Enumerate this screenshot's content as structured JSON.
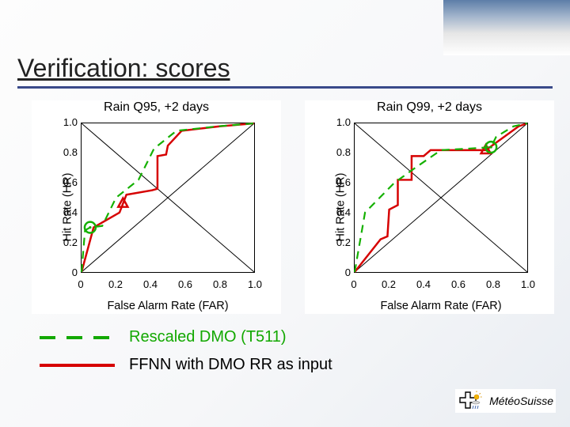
{
  "slide": {
    "title": "Verification: scores"
  },
  "legend": {
    "dashed_label": "Rescaled DMO (T511)",
    "solid_label": "FFNN with DMO RR as input"
  },
  "logo_text": "MétéoSuisse",
  "chart_data": [
    {
      "type": "line",
      "title": "Rain Q95, +2 days",
      "xlabel": "False Alarm Rate (FAR)",
      "ylabel": "Hit Rate (HR)",
      "xlim": [
        0,
        1.0
      ],
      "ylim": [
        0,
        1.0
      ],
      "xticks": [
        0,
        0.2,
        0.4,
        0.6,
        0.8,
        1.0
      ],
      "yticks": [
        0,
        0.2,
        0.4,
        0.6,
        0.8,
        1.0
      ],
      "series": [
        {
          "name": "FFNN",
          "style": "solid-red",
          "points": [
            [
              0.0,
              0.0
            ],
            [
              0.07,
              0.3
            ],
            [
              0.22,
              0.4
            ],
            [
              0.24,
              0.46
            ],
            [
              0.26,
              0.52
            ],
            [
              0.41,
              0.55
            ],
            [
              0.44,
              0.56
            ],
            [
              0.44,
              0.78
            ],
            [
              0.49,
              0.79
            ],
            [
              0.5,
              0.85
            ],
            [
              0.58,
              0.95
            ],
            [
              0.8,
              0.98
            ],
            [
              1.0,
              1.0
            ]
          ],
          "marker": {
            "shape": "triangle",
            "at": [
              0.24,
              0.46
            ]
          }
        },
        {
          "name": "Rescaled DMO",
          "style": "dashed-green",
          "points": [
            [
              0.0,
              0.0
            ],
            [
              0.02,
              0.28
            ],
            [
              0.05,
              0.3
            ],
            [
              0.12,
              0.31
            ],
            [
              0.2,
              0.5
            ],
            [
              0.33,
              0.62
            ],
            [
              0.42,
              0.83
            ],
            [
              0.55,
              0.95
            ],
            [
              0.79,
              0.98
            ],
            [
              1.0,
              1.0
            ]
          ],
          "marker": {
            "shape": "circle-dot",
            "at": [
              0.05,
              0.3
            ]
          }
        }
      ],
      "reference_diagonal": true
    },
    {
      "type": "line",
      "title": "Rain Q99, +2 days",
      "xlabel": "False Alarm Rate (FAR)",
      "ylabel": "Hit Rate (HR)",
      "xlim": [
        0,
        1.0
      ],
      "ylim": [
        0,
        1.0
      ],
      "xticks": [
        0,
        0.2,
        0.4,
        0.6,
        0.8,
        1.0
      ],
      "yticks": [
        0,
        0.2,
        0.4,
        0.6,
        0.8,
        1.0
      ],
      "series": [
        {
          "name": "FFNN",
          "style": "solid-red",
          "points": [
            [
              0.0,
              0.0
            ],
            [
              0.15,
              0.22
            ],
            [
              0.19,
              0.24
            ],
            [
              0.2,
              0.42
            ],
            [
              0.25,
              0.45
            ],
            [
              0.25,
              0.62
            ],
            [
              0.33,
              0.62
            ],
            [
              0.33,
              0.78
            ],
            [
              0.4,
              0.78
            ],
            [
              0.44,
              0.82
            ],
            [
              0.71,
              0.82
            ],
            [
              0.76,
              0.82
            ],
            [
              0.95,
              0.98
            ],
            [
              1.0,
              1.0
            ]
          ],
          "marker": {
            "shape": "triangle",
            "at": [
              0.76,
              0.82
            ]
          }
        },
        {
          "name": "Rescaled DMO",
          "style": "dashed-green",
          "points": [
            [
              0.0,
              0.0
            ],
            [
              0.06,
              0.4
            ],
            [
              0.23,
              0.6
            ],
            [
              0.35,
              0.7
            ],
            [
              0.5,
              0.82
            ],
            [
              0.66,
              0.83
            ],
            [
              0.79,
              0.84
            ],
            [
              0.82,
              0.91
            ],
            [
              0.92,
              0.98
            ],
            [
              1.0,
              1.0
            ]
          ],
          "marker": {
            "shape": "circle-dot",
            "at": [
              0.79,
              0.84
            ]
          }
        }
      ],
      "reference_diagonal": true
    }
  ]
}
